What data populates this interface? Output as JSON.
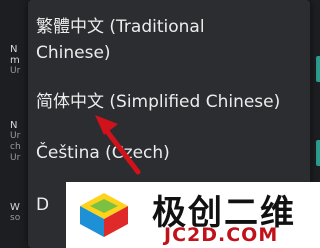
{
  "background_items": [
    {
      "title": "N",
      "sub": ""
    },
    {
      "title": "N",
      "sub": "m"
    },
    {
      "title": "",
      "sub": "Ur"
    },
    {
      "title": "N",
      "sub": ""
    },
    {
      "title": "",
      "sub": "Ur"
    },
    {
      "title": "",
      "sub": "ch"
    },
    {
      "title": "",
      "sub": "Ur"
    },
    {
      "title": "W",
      "sub": ""
    },
    {
      "title": "",
      "sub": "so"
    }
  ],
  "language_options": [
    {
      "line1": "繁體中文 (Traditional",
      "line2": "Chinese)"
    },
    {
      "line1": "简体中文 (Simplified Chinese)"
    },
    {
      "line1": "Čeština (Czech)"
    },
    {
      "line1": "D"
    }
  ],
  "watermark": {
    "cn_text": "极创二维",
    "url_text": "JC2D.COM"
  },
  "colors": {
    "background": "#1c1e21",
    "dialog": "#2b2d31",
    "text": "#ececec",
    "arrow": "#d0121b",
    "accent": "#2a9d8f",
    "watermark_url": "#c0121b"
  },
  "icons": [
    "red-arrow-icon",
    "cube-logo-icon"
  ]
}
